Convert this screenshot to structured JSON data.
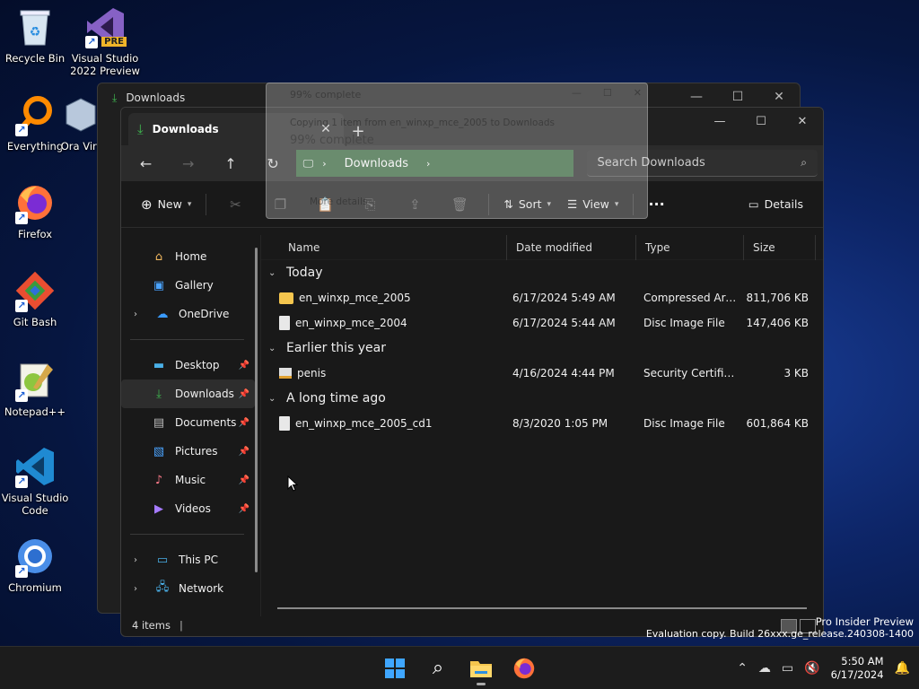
{
  "desktop": {
    "icons": [
      {
        "label": "Recycle Bin",
        "icon": "recycle-bin-icon"
      },
      {
        "label": "Visual Studio 2022 Preview",
        "icon": "visual-studio-icon",
        "badge": "PRE"
      },
      {
        "label": "Everything",
        "icon": "everything-search-icon"
      },
      {
        "label": "Ora Virt",
        "icon": "virtualbox-icon"
      },
      {
        "label": "Firefox",
        "icon": "firefox-icon"
      },
      {
        "label": "Git Bash",
        "icon": "git-bash-icon"
      },
      {
        "label": "Notepad++",
        "icon": "notepad-plus-plus-icon"
      },
      {
        "label": "Visual Studio Code",
        "icon": "vscode-icon"
      },
      {
        "label": "Chromium",
        "icon": "chromium-icon"
      }
    ]
  },
  "background_window": {
    "title": "Downloads"
  },
  "progress_dialog": {
    "title": "99% complete",
    "copy_text": "Copying 1 item from en_winxp_mce_2005 to Downloads",
    "percent_text": "99% complete",
    "more_details": "More details"
  },
  "explorer": {
    "tab_title": "Downloads",
    "tab_close": "✕",
    "new_tab": "+",
    "address": {
      "location": "Downloads"
    },
    "search_placeholder": "Search Downloads",
    "commands": {
      "new_label": "New",
      "sort_label": "Sort",
      "view_label": "View",
      "more_label": "···",
      "details_label": "Details"
    },
    "sidebar": {
      "home": "Home",
      "gallery": "Gallery",
      "onedrive": "OneDrive",
      "desktop": "Desktop",
      "downloads": "Downloads",
      "documents": "Documents",
      "pictures": "Pictures",
      "music": "Music",
      "videos": "Videos",
      "thispc": "This PC",
      "network": "Network"
    },
    "columns": {
      "name": "Name",
      "date": "Date modified",
      "type": "Type",
      "size": "Size"
    },
    "groups": [
      {
        "label": "Today",
        "files": [
          {
            "name": "en_winxp_mce_2005",
            "date": "6/17/2024 5:49 AM",
            "type": "Compressed Archi...",
            "size": "811,706 KB",
            "icon": "zip-folder-icon"
          },
          {
            "name": "en_winxp_mce_2004",
            "date": "6/17/2024 5:44 AM",
            "type": "Disc Image File",
            "size": "147,406 KB",
            "icon": "disc-image-icon"
          }
        ]
      },
      {
        "label": "Earlier this year",
        "files": [
          {
            "name": "penis",
            "date": "4/16/2024 4:44 PM",
            "type": "Security Certificate",
            "size": "3 KB",
            "icon": "certificate-icon"
          }
        ]
      },
      {
        "label": "A long time ago",
        "files": [
          {
            "name": "en_winxp_mce_2005_cd1",
            "date": "8/3/2020 1:05 PM",
            "type": "Disc Image File",
            "size": "601,864 KB",
            "icon": "disc-image-icon"
          }
        ]
      }
    ],
    "status": "4 items"
  },
  "watermark": {
    "line1": "Pro Insider Preview",
    "line2": "Evaluation copy. Build 26xxx.ge_release.240308-1400"
  },
  "taskbar": {
    "time": "5:50 AM",
    "date": "6/17/2024"
  },
  "colors": {
    "accent_green": "#3a6a3f",
    "folder_yellow": "#f5c64e",
    "download_green": "#3fb950"
  }
}
